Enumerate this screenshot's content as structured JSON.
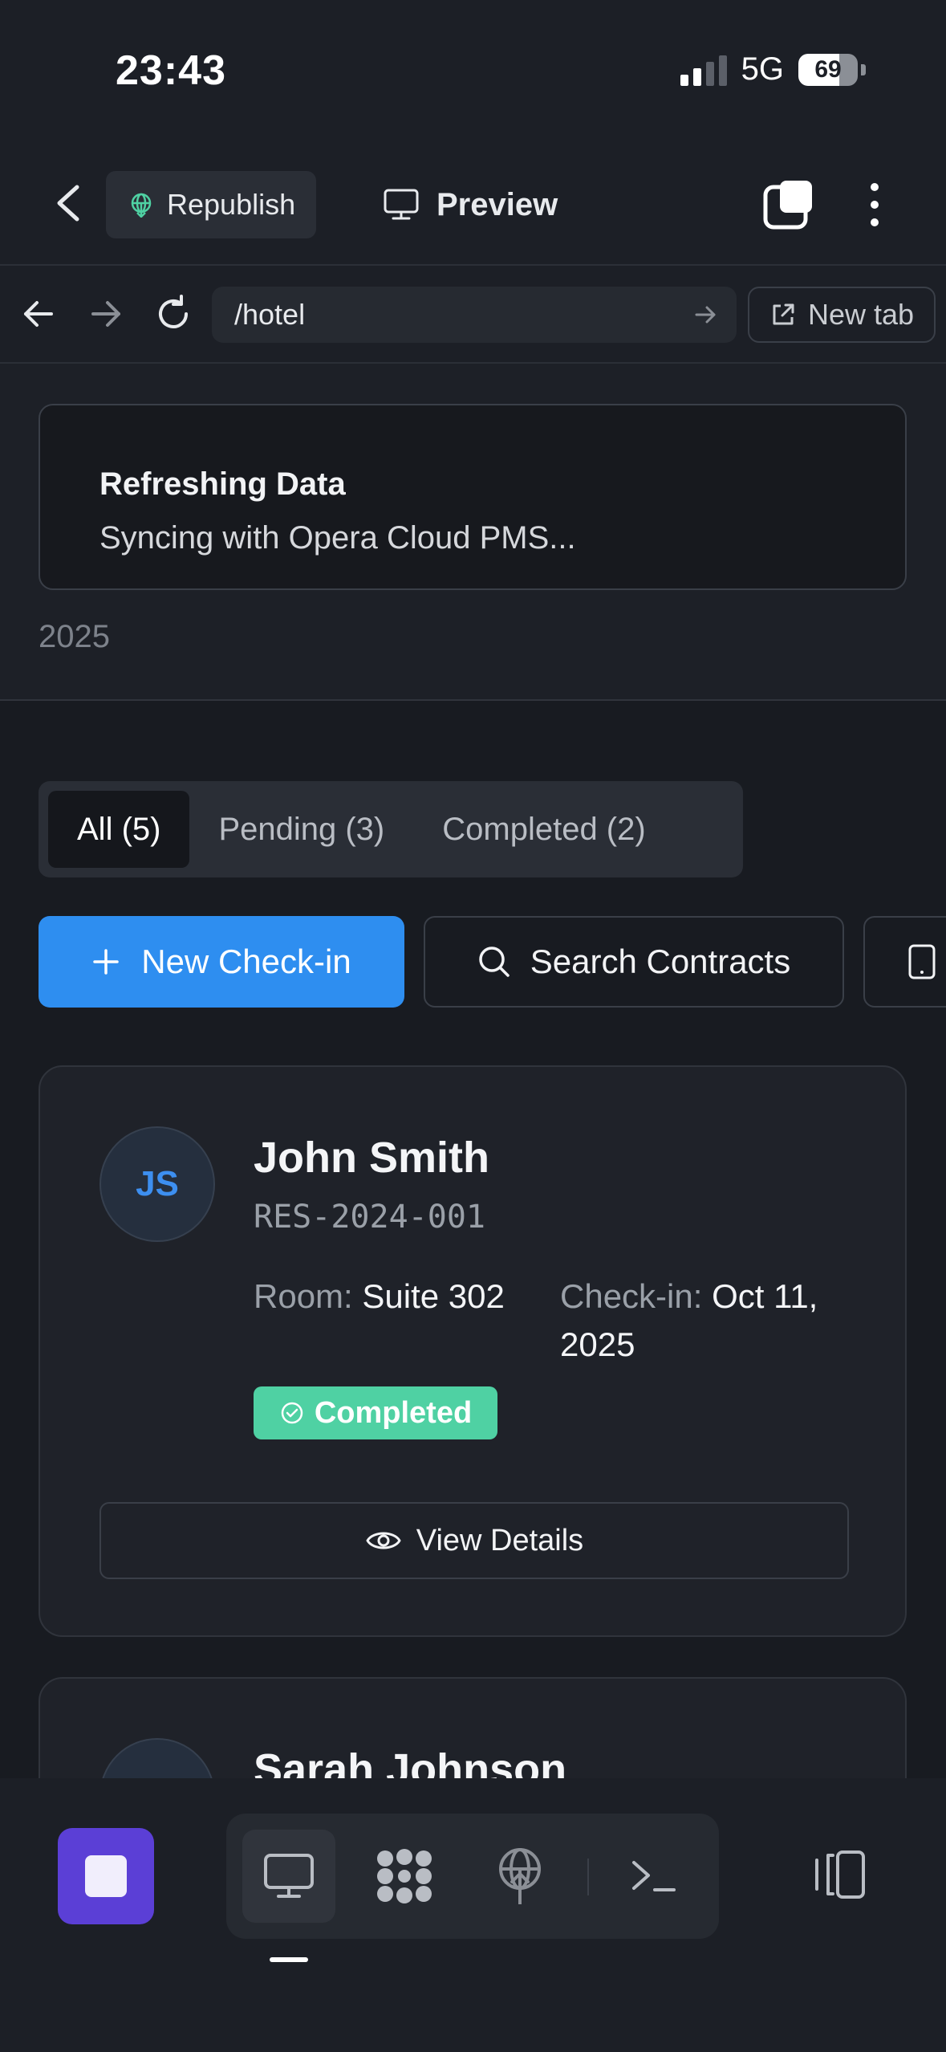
{
  "status": {
    "time": "23:43",
    "network": "5G",
    "battery": "69",
    "battery_level": 0.69
  },
  "toolbar": {
    "republish_label": "Republish",
    "preview_label": "Preview",
    "icons": [
      "back-icon",
      "globe-icon",
      "monitor-icon",
      "tabs-icon",
      "more-vertical-icon"
    ]
  },
  "urlbar": {
    "path": "/hotel",
    "new_tab_label": "New tab",
    "icons": [
      "arrow-left-icon",
      "arrow-right-icon",
      "refresh-icon",
      "arrow-go-icon",
      "external-link-icon"
    ]
  },
  "toast": {
    "title": "Refreshing Data",
    "description": "Syncing with Opera Cloud PMS..."
  },
  "header": {
    "year": "2025"
  },
  "filters": {
    "tabs": [
      {
        "label": "All (5)",
        "active": true
      },
      {
        "label": "Pending (3)",
        "active": false
      },
      {
        "label": "Completed (2)",
        "active": false
      }
    ]
  },
  "actions": {
    "new_checkin": "New Check-in",
    "search_contracts": "Search Contracts"
  },
  "reservations": [
    {
      "initials": "JS",
      "name": "John Smith",
      "code": "RES-2024-001",
      "room_label": "Room:",
      "room": "Suite 302",
      "checkin_label": "Check-in:",
      "checkin": "Oct 11, 2025",
      "status": "Completed",
      "details_label": "View Details"
    },
    {
      "name": "Sarah Johnson"
    }
  ],
  "colors": {
    "accent": "#2e8ef0",
    "success": "#4fd1a3",
    "stop": "#5b3fd6",
    "background": "#181b21"
  },
  "bottom_bar": {
    "icons": [
      "stop-icon",
      "monitor-icon",
      "apps-icon",
      "deploy-icon",
      "terminal-icon",
      "panel-toggle-icon"
    ]
  }
}
